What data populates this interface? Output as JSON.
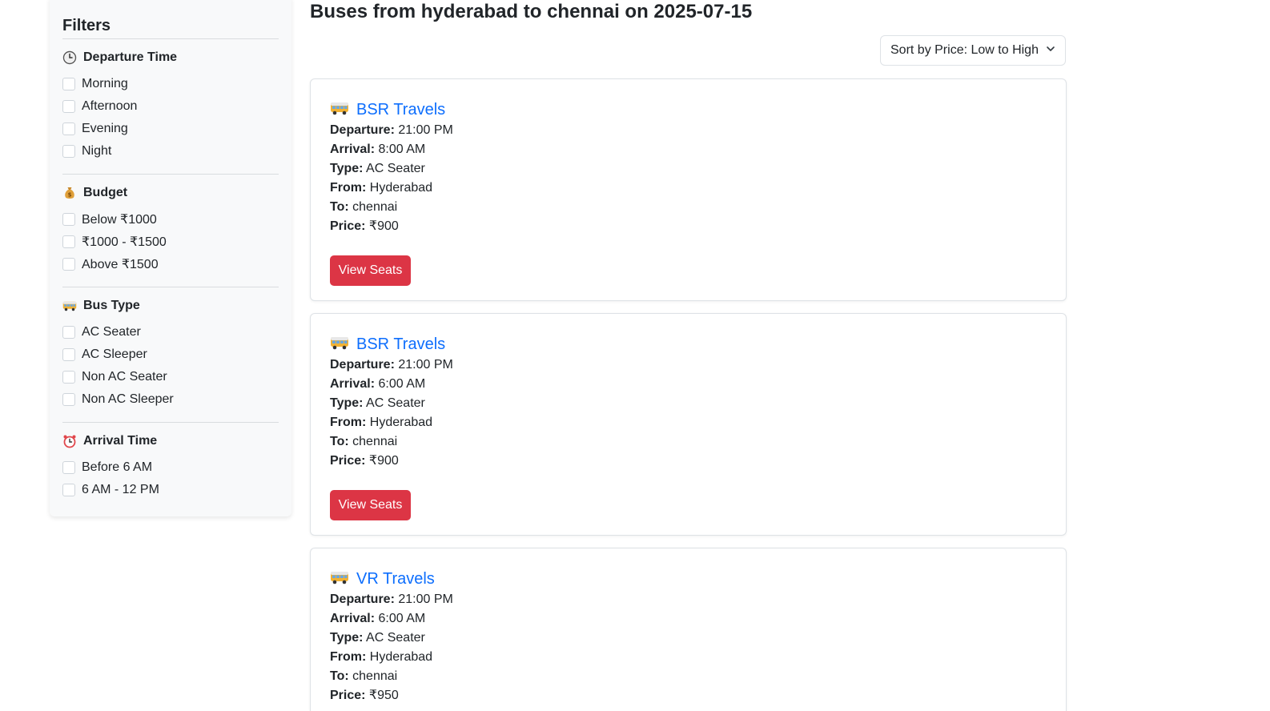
{
  "sidebar": {
    "title": "Filters",
    "sections": [
      {
        "title": "Departure Time",
        "icon": "clock-icon",
        "options": [
          "Morning",
          "Afternoon",
          "Evening",
          "Night"
        ]
      },
      {
        "title": "Budget",
        "icon": "money-bag-icon",
        "options": [
          "Below ₹1000",
          "₹1000 - ₹1500",
          "Above ₹1500"
        ]
      },
      {
        "title": "Bus Type",
        "icon": "bus-icon",
        "options": [
          "AC Seater",
          "AC Sleeper",
          "Non AC Seater",
          "Non AC Sleeper"
        ]
      },
      {
        "title": "Arrival Time",
        "icon": "alarm-clock-icon",
        "options": [
          "Before 6 AM",
          "6 AM - 12 PM"
        ]
      }
    ]
  },
  "header": {
    "title": "Buses from hyderabad to chennai on 2025-07-15"
  },
  "sort": {
    "selected": "Sort by Price: Low to High"
  },
  "labels": {
    "departure": "Departure:",
    "arrival": "Arrival:",
    "type": "Type:",
    "from": "From:",
    "to": "To:",
    "price": "Price:",
    "view_seats": "View Seats"
  },
  "buses": [
    {
      "name": "BSR Travels",
      "departure": "21:00 PM",
      "arrival": "8:00 AM",
      "type": "AC Seater",
      "from": "Hyderabad",
      "to": "chennai",
      "price": "₹900"
    },
    {
      "name": "BSR Travels",
      "departure": "21:00 PM",
      "arrival": "6:00 AM",
      "type": "AC Seater",
      "from": "Hyderabad",
      "to": "chennai",
      "price": "₹900"
    },
    {
      "name": "VR Travels",
      "departure": "21:00 PM",
      "arrival": "6:00 AM",
      "type": "AC Seater",
      "from": "Hyderabad",
      "to": "chennai",
      "price": "₹950"
    }
  ],
  "colors": {
    "accent": "#0d6efd",
    "button": "#dc3545",
    "sidebar_bg": "#f8f9fa"
  }
}
